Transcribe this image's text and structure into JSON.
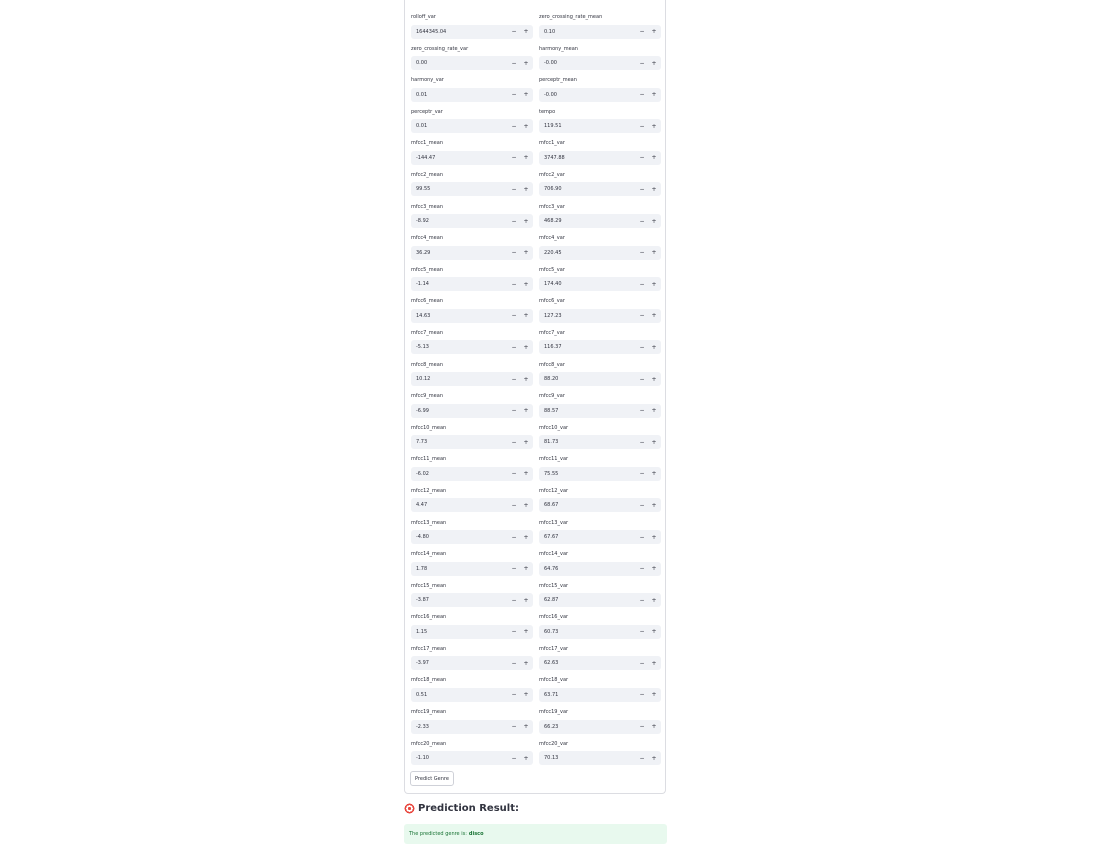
{
  "fields": [
    {
      "label": "rolloff_var",
      "value": "1644345.04"
    },
    {
      "label": "zero_crossing_rate_mean",
      "value": "0.10"
    },
    {
      "label": "zero_crossing_rate_var",
      "value": "0.00"
    },
    {
      "label": "harmony_mean",
      "value": "-0.00"
    },
    {
      "label": "harmony_var",
      "value": "0.01"
    },
    {
      "label": "perceptr_mean",
      "value": "-0.00"
    },
    {
      "label": "perceptr_var",
      "value": "0.01"
    },
    {
      "label": "tempo",
      "value": "119.51"
    },
    {
      "label": "mfcc1_mean",
      "value": "-144.47"
    },
    {
      "label": "mfcc1_var",
      "value": "3747.88"
    },
    {
      "label": "mfcc2_mean",
      "value": "99.55"
    },
    {
      "label": "mfcc2_var",
      "value": "706.90"
    },
    {
      "label": "mfcc3_mean",
      "value": "-8.92"
    },
    {
      "label": "mfcc3_var",
      "value": "468.29"
    },
    {
      "label": "mfcc4_mean",
      "value": "36.29"
    },
    {
      "label": "mfcc4_var",
      "value": "220.45"
    },
    {
      "label": "mfcc5_mean",
      "value": "-1.14"
    },
    {
      "label": "mfcc5_var",
      "value": "174.40"
    },
    {
      "label": "mfcc6_mean",
      "value": "14.63"
    },
    {
      "label": "mfcc6_var",
      "value": "127.23"
    },
    {
      "label": "mfcc7_mean",
      "value": "-5.13"
    },
    {
      "label": "mfcc7_var",
      "value": "116.37"
    },
    {
      "label": "mfcc8_mean",
      "value": "10.12"
    },
    {
      "label": "mfcc8_var",
      "value": "88.20"
    },
    {
      "label": "mfcc9_mean",
      "value": "-6.99"
    },
    {
      "label": "mfcc9_var",
      "value": "88.57"
    },
    {
      "label": "mfcc10_mean",
      "value": "7.73"
    },
    {
      "label": "mfcc10_var",
      "value": "81.73"
    },
    {
      "label": "mfcc11_mean",
      "value": "-6.02"
    },
    {
      "label": "mfcc11_var",
      "value": "75.55"
    },
    {
      "label": "mfcc12_mean",
      "value": "4.47"
    },
    {
      "label": "mfcc12_var",
      "value": "68.67"
    },
    {
      "label": "mfcc13_mean",
      "value": "-4.80"
    },
    {
      "label": "mfcc13_var",
      "value": "67.67"
    },
    {
      "label": "mfcc14_mean",
      "value": "1.78"
    },
    {
      "label": "mfcc14_var",
      "value": "64.76"
    },
    {
      "label": "mfcc15_mean",
      "value": "-3.87"
    },
    {
      "label": "mfcc15_var",
      "value": "62.87"
    },
    {
      "label": "mfcc16_mean",
      "value": "1.15"
    },
    {
      "label": "mfcc16_var",
      "value": "60.73"
    },
    {
      "label": "mfcc17_mean",
      "value": "-3.97"
    },
    {
      "label": "mfcc17_var",
      "value": "62.63"
    },
    {
      "label": "mfcc18_mean",
      "value": "0.51"
    },
    {
      "label": "mfcc18_var",
      "value": "63.71"
    },
    {
      "label": "mfcc19_mean",
      "value": "-2.33"
    },
    {
      "label": "mfcc19_var",
      "value": "66.23"
    },
    {
      "label": "mfcc20_mean",
      "value": "-1.10"
    },
    {
      "label": "mfcc20_var",
      "value": "70.13"
    }
  ],
  "stepper": {
    "minus": "−",
    "plus": "+"
  },
  "submit_label": "Predict Genre",
  "result": {
    "icon": "target-icon",
    "heading": "Prediction Result:",
    "message_prefix": "The predicted genre is:",
    "genre": "disco"
  },
  "colors": {
    "input_bg": "#f0f2f6",
    "success_bg": "#e8f9ee",
    "success_text": "#177233"
  }
}
